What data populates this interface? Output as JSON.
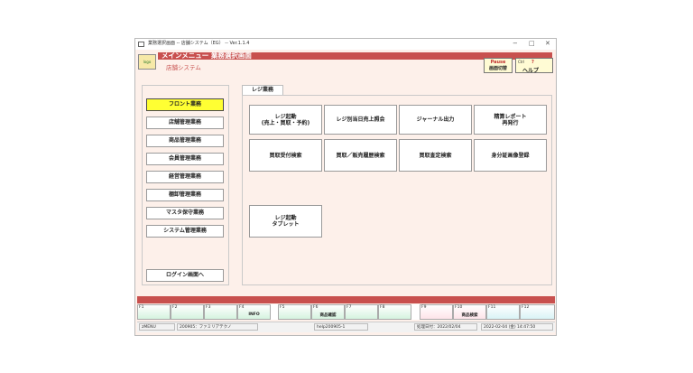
{
  "window": {
    "title": "業務選択画面 -- 店舗システム（EG） -- Ver.1.1.4",
    "minimize": "−",
    "maximize": "□",
    "close": "✕"
  },
  "header": {
    "logo_text": "logo",
    "title": "メインメニュー  業務選択画面",
    "subtitle": "店舗システム",
    "pause_key": "Pause",
    "pause_label": "画面切替",
    "help_key": "Ctrl",
    "help_q": "?",
    "help_label": "ヘルプ"
  },
  "sidebar": {
    "items": [
      {
        "label": "フロント業務"
      },
      {
        "label": "店舗管理業務"
      },
      {
        "label": "商品管理業務"
      },
      {
        "label": "会員管理業務"
      },
      {
        "label": "経営管理業務"
      },
      {
        "label": "棚卸管理業務"
      },
      {
        "label": "マスタ保守業務"
      },
      {
        "label": "システム管理業務"
      }
    ],
    "logout": "ログイン画面へ"
  },
  "main": {
    "tab": "レジ業務",
    "buttons": [
      {
        "label": "レジ起動\n(売上・買取・予約)"
      },
      {
        "label": "レジ別当日売上照会"
      },
      {
        "label": "ジャーナル出力"
      },
      {
        "label": "精算レポート\n再発行"
      },
      {
        "label": "買取受付検索"
      },
      {
        "label": "買取／販売履歴検索"
      },
      {
        "label": "買取査定検索"
      },
      {
        "label": "身分証画像登録"
      },
      {
        "label": "レジ起動\nタブレット"
      }
    ]
  },
  "fkeys": [
    {
      "key": "F1",
      "label": ""
    },
    {
      "key": "F2",
      "label": ""
    },
    {
      "key": "F3",
      "label": ""
    },
    {
      "key": "F4",
      "label": "INFO"
    },
    {
      "key": "F5",
      "label": ""
    },
    {
      "key": "F6",
      "label": "商品確認"
    },
    {
      "key": "F7",
      "label": ""
    },
    {
      "key": "F8",
      "label": ""
    },
    {
      "key": "F9",
      "label": ""
    },
    {
      "key": "F10",
      "label": "商品検索"
    },
    {
      "key": "F11",
      "label": ""
    },
    {
      "key": "F12",
      "label": ""
    }
  ],
  "status": {
    "screen": "zMENU",
    "user": "200905：ファミリアテクノ",
    "help_id": "help200905-1",
    "proc_date": "処理日付：2022/02/04",
    "datetime": "2022-02-04 (金) 14:47:50"
  },
  "colors": {
    "accent": "#c8504e",
    "background": "#fdf0ea",
    "active": "#ffff33"
  }
}
